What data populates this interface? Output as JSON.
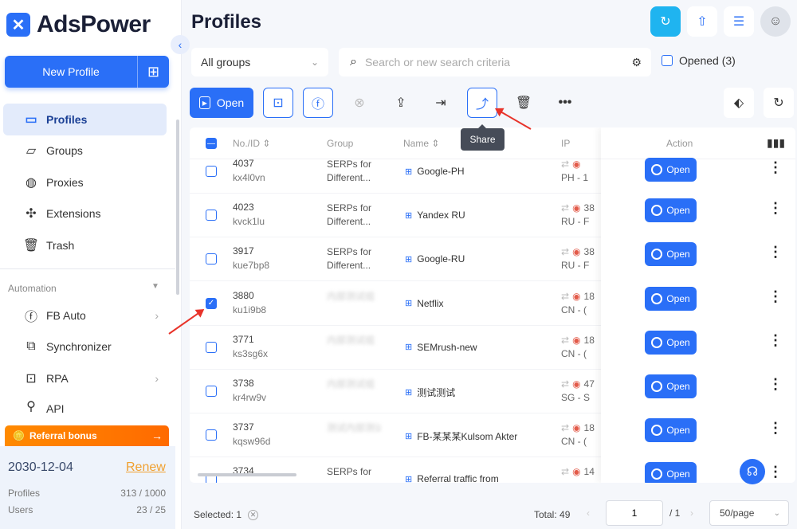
{
  "app": {
    "name": "AdsPower"
  },
  "sidebar": {
    "new_profile": "New Profile",
    "items": [
      {
        "label": "Profiles",
        "icon": "id-card-icon",
        "active": true
      },
      {
        "label": "Groups",
        "icon": "folder-icon"
      },
      {
        "label": "Proxies",
        "icon": "globe-icon"
      },
      {
        "label": "Extensions",
        "icon": "puzzle-icon"
      },
      {
        "label": "Trash",
        "icon": "trash-icon"
      }
    ],
    "automation_label": "Automation",
    "automation_items": [
      {
        "label": "FB Auto",
        "icon": "facebook-icon",
        "chevron": true
      },
      {
        "label": "Synchronizer",
        "icon": "sync-icon",
        "chevron": false
      },
      {
        "label": "RPA",
        "icon": "robot-icon",
        "chevron": true
      },
      {
        "label": "API",
        "icon": "api-icon",
        "chevron": false
      }
    ],
    "referral": "Referral bonus",
    "plan": {
      "date": "2030-12-04",
      "renew": "Renew",
      "profiles_label": "Profiles",
      "profiles_value": "313 / 1000",
      "users_label": "Users",
      "users_value": "23 / 25"
    }
  },
  "header": {
    "title": "Profiles"
  },
  "filters": {
    "group": "All groups",
    "search_placeholder": "Search or new search criteria",
    "opened": "Opened (3)"
  },
  "toolbar": {
    "open_label": "Open",
    "share_tooltip": "Share"
  },
  "table": {
    "columns": {
      "no": "No./ID",
      "group": "Group",
      "name": "Name",
      "ip": "IP",
      "action": "Action"
    },
    "action_label": "Open",
    "rows": [
      {
        "no": "4037",
        "id": "kx4l0vn",
        "group": "SERPs for Different...",
        "name": "Google-PH",
        "ip1": "",
        "ip2": "PH - 1",
        "checked": false,
        "blur_group": false
      },
      {
        "no": "4023",
        "id": "kvck1lu",
        "group": "SERPs for Different...",
        "name": "Yandex RU",
        "ip1": "38",
        "ip2": "RU - F",
        "checked": false,
        "blur_group": false
      },
      {
        "no": "3917",
        "id": "kue7bp8",
        "group": "SERPs for Different...",
        "name": "Google-RU",
        "ip1": "38",
        "ip2": "RU - F",
        "checked": false,
        "blur_group": false
      },
      {
        "no": "3880",
        "id": "ku1i9b8",
        "group": "内部测试组",
        "name": "Netflix",
        "ip1": "18",
        "ip2": "CN - (",
        "checked": true,
        "blur_group": true
      },
      {
        "no": "3771",
        "id": "ks3sg6x",
        "group": "内部测试组",
        "name": "SEMrush-new",
        "ip1": "18",
        "ip2": "CN - (",
        "checked": false,
        "blur_group": true
      },
      {
        "no": "3738",
        "id": "kr4rw9v",
        "group": "内部测试组",
        "name": "测试测试",
        "ip1": "47",
        "ip2": "SG - S",
        "checked": false,
        "blur_group": true
      },
      {
        "no": "3737",
        "id": "kqsw96d",
        "group": "测试内部测试组",
        "name": "FB-某某某Kulsom Akter",
        "ip1": "18",
        "ip2": "CN - (",
        "checked": false,
        "blur_group": true
      },
      {
        "no": "3734",
        "id": "",
        "group": "SERPs for",
        "name": "Referral traffic from",
        "ip1": "14",
        "ip2": "",
        "checked": false,
        "blur_group": false
      }
    ]
  },
  "footer": {
    "selected": "Selected: 1",
    "total": "Total: 49",
    "page": "1",
    "page_total": "/ 1",
    "per_page": "50/page"
  },
  "colors": {
    "accent": "#2a6ff7",
    "annotation_arrow": "#e8332a",
    "referral": "#ff7a00"
  }
}
